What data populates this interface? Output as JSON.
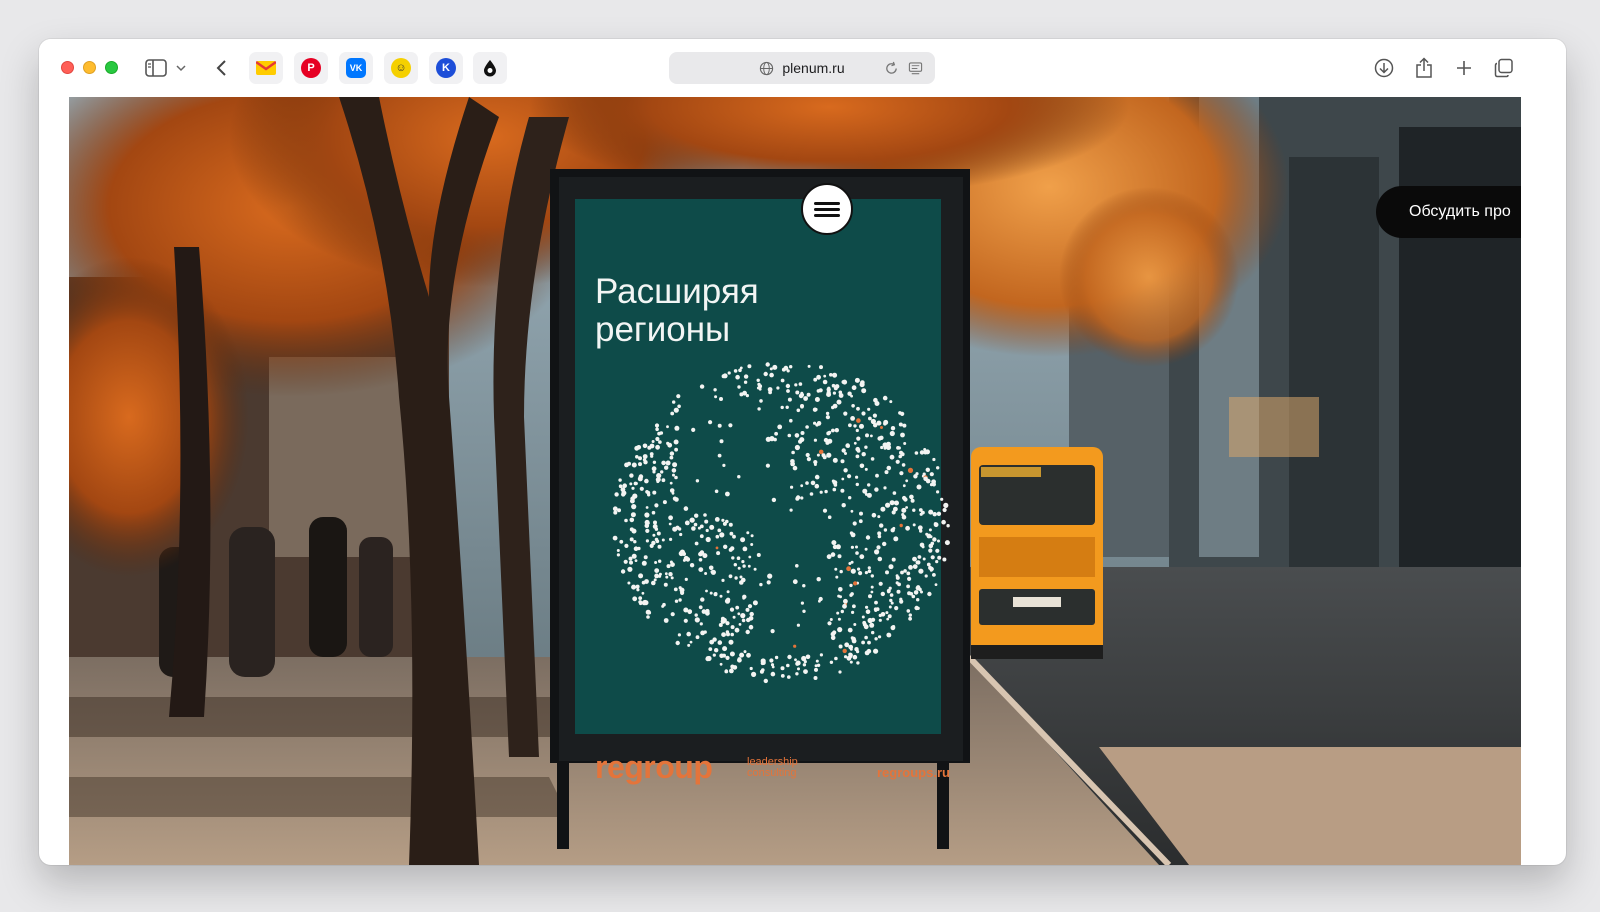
{
  "browser": {
    "url": "plenum.ru",
    "favorites": [
      {
        "icon": "mail-icon",
        "color": "#ffcc00"
      },
      {
        "icon": "pinterest-icon",
        "color": "#e60023"
      },
      {
        "icon": "vk-icon",
        "color": "#0077ff"
      },
      {
        "icon": "face-icon",
        "color": "#f5d000"
      },
      {
        "icon": "k-icon",
        "color": "#1d4ed8"
      },
      {
        "icon": "drop-icon",
        "color": "#111111"
      }
    ]
  },
  "site": {
    "cta_label": "Обсудить про",
    "poster": {
      "title_line1": "Расширяя",
      "title_line2": "регионы",
      "brand": "regroup",
      "brand_sub_line1": "leadership",
      "brand_sub_line2": "consulting",
      "url": "regroups.ru"
    }
  },
  "colors": {
    "poster_bg": "#0e4b49",
    "brand_orange": "#e4743a",
    "bus_orange": "#f39a1e"
  }
}
